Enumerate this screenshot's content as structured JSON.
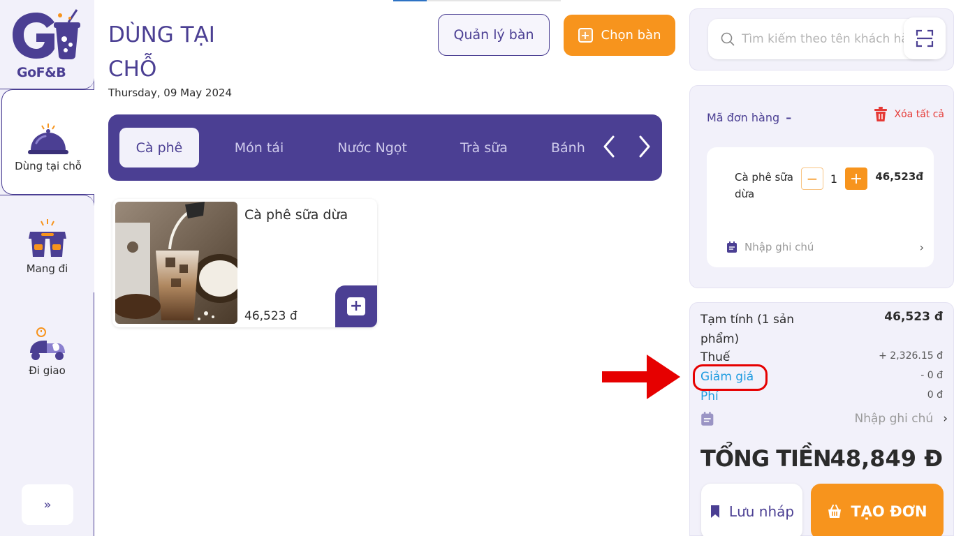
{
  "brand": {
    "logo_text": "GoF&B"
  },
  "sidebar": {
    "items": [
      {
        "label": "Dùng tại chỗ",
        "icon": "food-cloche-icon",
        "active": true
      },
      {
        "label": "Mang đi",
        "icon": "takeaway-bag-icon",
        "active": false
      },
      {
        "label": "Đi giao",
        "icon": "delivery-scooter-icon",
        "active": false
      }
    ],
    "expand_label": "»"
  },
  "header": {
    "title": "DÙNG TẠI CHỖ",
    "date": "Thursday, 09 May 2024",
    "manage_tables_label": "Quản lý bàn",
    "choose_table_label": "Chọn bàn"
  },
  "categories": {
    "tabs": [
      "Cà phê",
      "Món tái",
      "Nước Ngọt",
      "Trà sữa",
      "Bánh"
    ],
    "active_index": 0,
    "prev_icon": "‹",
    "next_icon": "›"
  },
  "products": [
    {
      "name": "Cà phê sữa dừa",
      "price": "46,523 đ"
    }
  ],
  "search": {
    "placeholder": "Tìm kiếm theo tên khách hàng"
  },
  "order": {
    "code_label": "Mã đơn hàng",
    "code_value": "–",
    "clear_all_label": "Xóa tất cả",
    "items": [
      {
        "name": "Cà phê sữa dừa",
        "quantity": "1",
        "price": "46,523đ",
        "note_placeholder": "Nhập ghi chú"
      }
    ]
  },
  "summary": {
    "subtotal_label": "Tạm tính  (1 sản phẩm)",
    "subtotal_value": "46,523 đ",
    "tax_label": "Thuế",
    "tax_value": "+ 2,326.15 đ",
    "discount_label": "Giảm giá",
    "discount_value": "- 0 đ",
    "fee_label": "Phí",
    "fee_value": "0 đ",
    "note_placeholder": "Nhập ghi chú",
    "total_label": "TỔNG TIỀN",
    "total_value": "48,849 Đ",
    "draft_label": "Lưu nháp",
    "create_label": "TẠO ĐƠN"
  },
  "colors": {
    "primary": "#4b3f93",
    "accent": "#f7941d",
    "link": "#1e9be0",
    "danger": "#e53935",
    "annotation": "#e60000"
  }
}
